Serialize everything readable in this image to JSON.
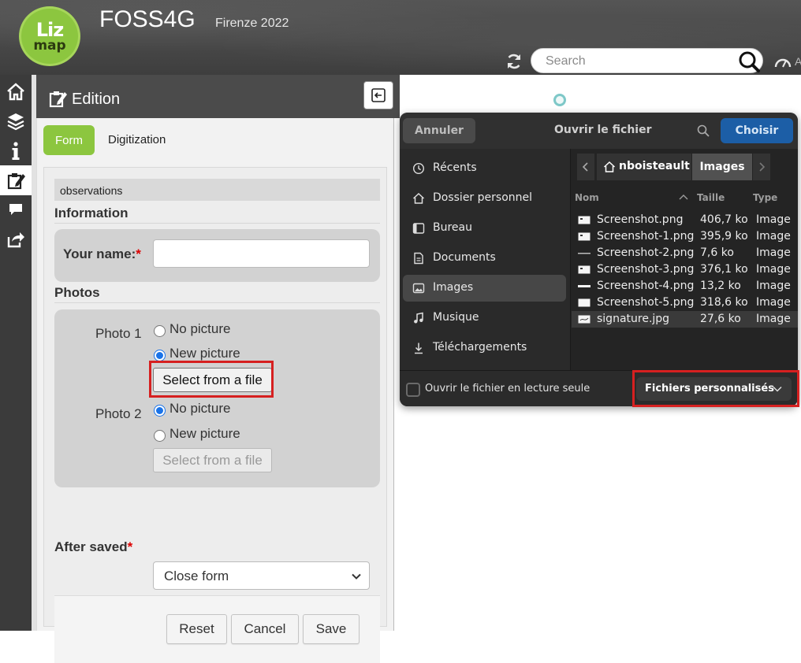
{
  "header": {
    "logo_line1": "Liz",
    "logo_line2": "map",
    "title": "FOSS4G",
    "subtitle": "Firenze 2022",
    "search_placeholder": "Search",
    "cut_text": "A"
  },
  "menu": {
    "items": [
      "home",
      "layers",
      "information",
      "edition",
      "comments",
      "share"
    ],
    "active": "edition"
  },
  "dock": {
    "title": "Edition",
    "tabs": {
      "form": "Form",
      "digitization": "Digitization"
    },
    "layer_name": "observations",
    "information_legend": "Information",
    "your_name_label": "Your name:",
    "required_mark": "*",
    "your_name_value": "",
    "photos_legend": "Photos",
    "photo1": {
      "label": "Photo 1",
      "option_no": "No picture",
      "option_new": "New picture",
      "selected": "New picture",
      "button": "Select from a file"
    },
    "photo2": {
      "label": "Photo 2",
      "option_no": "No picture",
      "option_new": "New picture",
      "selected": "No picture",
      "button": "Select from a file"
    },
    "after_saved_label": "After saved",
    "after_saved_value": "Close form",
    "buttons": {
      "reset": "Reset",
      "cancel": "Cancel",
      "save": "Save"
    }
  },
  "dialog": {
    "cancel_label": "Annuler",
    "title": "Ouvrir le fichier",
    "choose_label": "Choisir",
    "places": [
      {
        "label": "Récents",
        "icon": "clock-icon"
      },
      {
        "label": "Dossier personnel",
        "icon": "home-icon"
      },
      {
        "label": "Bureau",
        "icon": "desktop-icon"
      },
      {
        "label": "Documents",
        "icon": "document-icon"
      },
      {
        "label": "Images",
        "icon": "image-icon"
      },
      {
        "label": "Musique",
        "icon": "music-icon"
      },
      {
        "label": "Téléchargements",
        "icon": "download-icon"
      }
    ],
    "active_place": "Images",
    "path": [
      "nboisteault",
      "Images"
    ],
    "columns": {
      "name": "Nom",
      "size": "Taille",
      "type": "Type"
    },
    "files": [
      {
        "name": "Screenshot.png",
        "size": "406,7 ko",
        "type": "Image"
      },
      {
        "name": "Screenshot-1.png",
        "size": "395,9 ko",
        "type": "Image"
      },
      {
        "name": "Screenshot-2.png",
        "size": "7,6 ko",
        "type": "Image"
      },
      {
        "name": "Screenshot-3.png",
        "size": "376,1 ko",
        "type": "Image"
      },
      {
        "name": "Screenshot-4.png",
        "size": "13,2 ko",
        "type": "Image"
      },
      {
        "name": "Screenshot-5.png",
        "size": "318,6 ko",
        "type": "Image"
      },
      {
        "name": "signature.jpg",
        "size": "27,6 ko",
        "type": "Image"
      }
    ],
    "selected_file": "signature.jpg",
    "readonly_label": "Ouvrir le fichier en lecture seule",
    "filter_label": "Fichiers personnalisés"
  },
  "colors": {
    "brand_green": "#8cc63f",
    "highlight_red": "#d62020",
    "dialog_accent": "#1c5ea6"
  }
}
